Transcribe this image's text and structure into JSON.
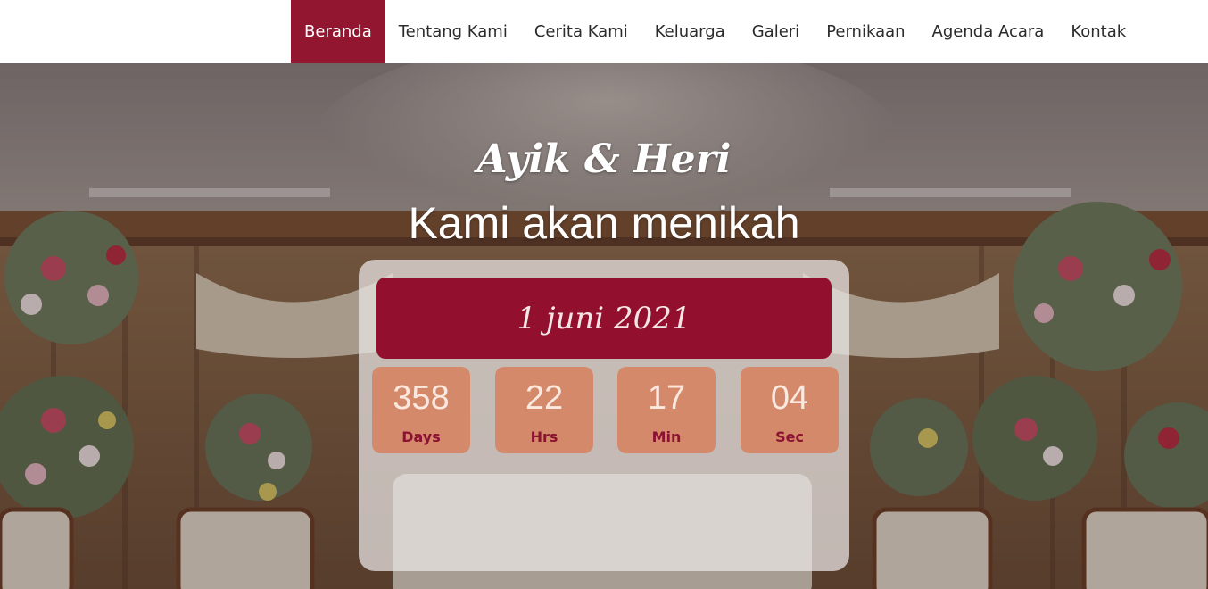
{
  "nav": {
    "items": [
      {
        "label": "Beranda",
        "active": true
      },
      {
        "label": "Tentang Kami",
        "active": false
      },
      {
        "label": "Cerita Kami",
        "active": false
      },
      {
        "label": "Keluarga",
        "active": false
      },
      {
        "label": "Galeri",
        "active": false
      },
      {
        "label": "Pernikaan",
        "active": false
      },
      {
        "label": "Agenda Acara",
        "active": false
      },
      {
        "label": "Kontak",
        "active": false
      }
    ]
  },
  "hero": {
    "couple": "Ayik & Heri",
    "tagline": "Kami akan menikah",
    "background": "wedding-stage-photo"
  },
  "countdown": {
    "date": "1 juni 2021",
    "units": [
      {
        "value": "358",
        "label": "Days"
      },
      {
        "value": "22",
        "label": "Hrs"
      },
      {
        "value": "17",
        "label": "Min"
      },
      {
        "value": "04",
        "label": "Sec"
      }
    ]
  },
  "colors": {
    "accent": "#921630",
    "tile": "#d68260",
    "tile_label": "#8c1231",
    "nav_text": "#2b2b2b"
  }
}
